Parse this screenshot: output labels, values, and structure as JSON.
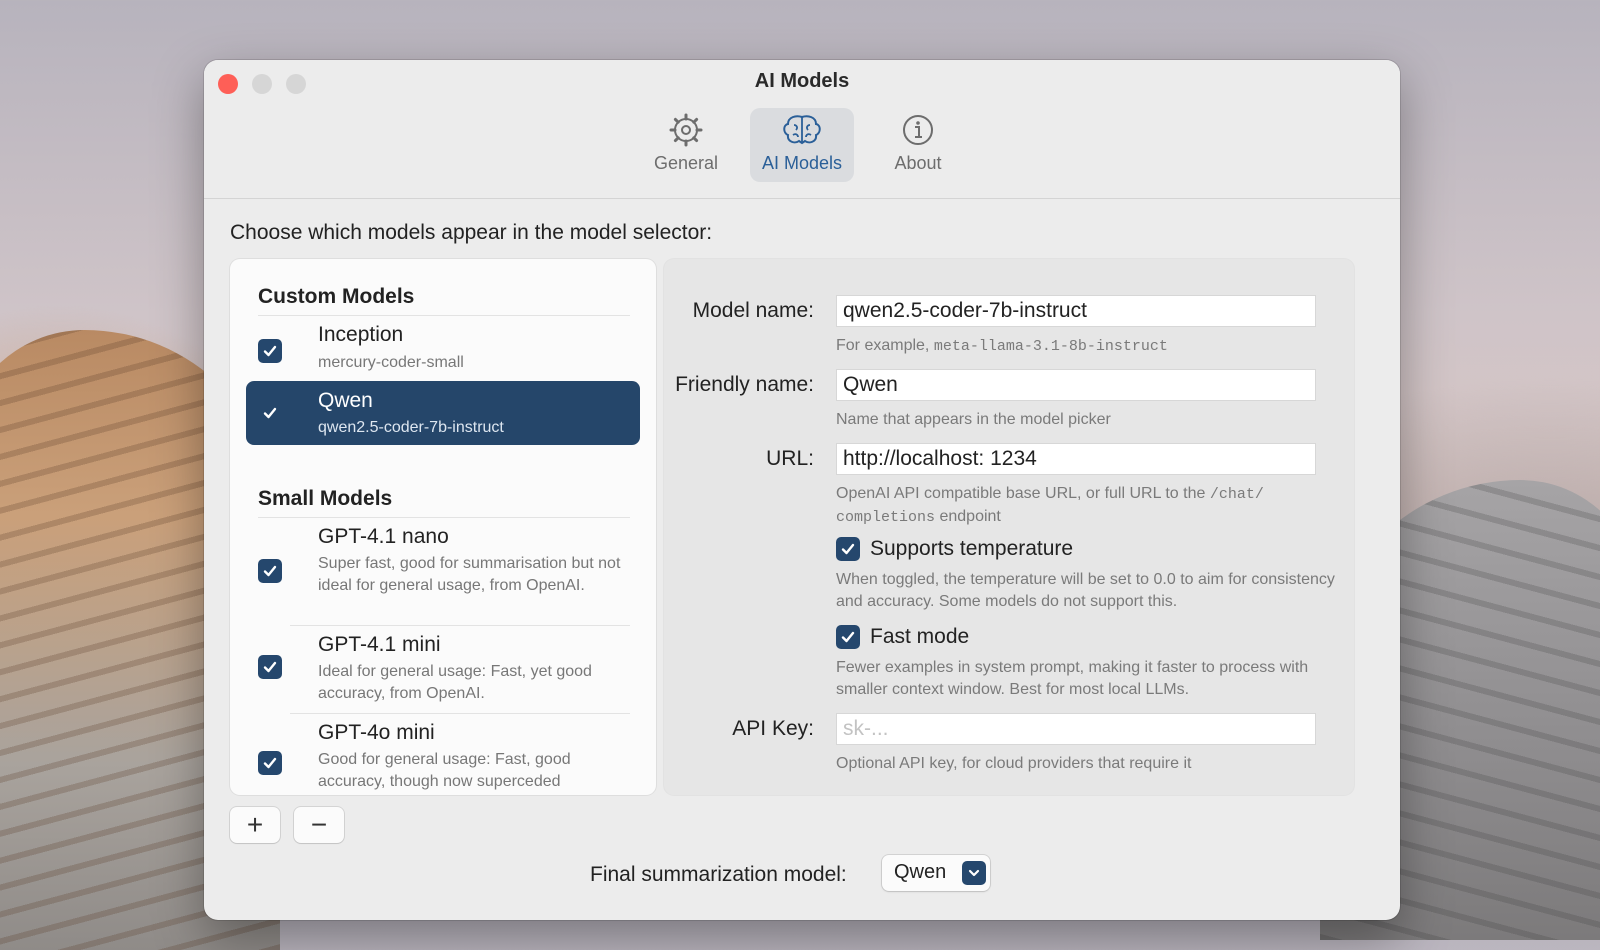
{
  "window": {
    "title": "AI Models"
  },
  "toolbar": {
    "tabs": [
      {
        "label": "General",
        "icon": "gear-icon"
      },
      {
        "label": "AI Models",
        "icon": "brain-icon"
      },
      {
        "label": "About",
        "icon": "info-icon"
      }
    ],
    "active_tab": "AI Models"
  },
  "main": {
    "instruction": "Choose which models appear in the model selector:",
    "sections": [
      {
        "title": "Custom Models",
        "items": [
          {
            "name": "Inception",
            "detail": "mercury-coder-small",
            "checked": true,
            "selected": false
          },
          {
            "name": "Qwen",
            "detail": "qwen2.5-coder-7b-instruct",
            "checked": true,
            "selected": true
          }
        ]
      },
      {
        "title": "Small Models",
        "items": [
          {
            "name": "GPT-4.1 nano",
            "detail": "Super fast, good for summarisation but not ideal for general usage, from OpenAI.",
            "checked": true,
            "selected": false
          },
          {
            "name": "GPT-4.1 mini",
            "detail": "Ideal for general usage: Fast, yet good accuracy, from OpenAI.",
            "checked": true,
            "selected": false
          },
          {
            "name": "GPT-4o mini",
            "detail": "Good for general usage: Fast, good accuracy, though now superceded",
            "checked": true,
            "selected": false
          }
        ]
      }
    ],
    "add_label": "+",
    "remove_label": "−"
  },
  "form": {
    "model_name": {
      "label": "Model name:",
      "value": "qwen2.5-coder-7b-instruct",
      "help_prefix": "For example, ",
      "help_code": "meta-llama-3.1-8b-instruct"
    },
    "friendly_name": {
      "label": "Friendly name:",
      "value": "Qwen",
      "help": "Name that appears in the model picker"
    },
    "url": {
      "label": "URL:",
      "value": "http://localhost: 1234",
      "help_prefix": "OpenAI API compatible base URL, or full URL to the ",
      "help_code": "/chat/ completions",
      "help_suffix": " endpoint"
    },
    "supports_temperature": {
      "label": "Supports temperature",
      "checked": true,
      "help": "When toggled, the temperature will be set to 0.0 to aim for consistency and accuracy. Some models do not support this."
    },
    "fast_mode": {
      "label": "Fast mode",
      "checked": true,
      "help": "Fewer examples in system prompt, making it faster to process with smaller context window. Best for most local LLMs."
    },
    "api_key": {
      "label": "API Key:",
      "value": "",
      "placeholder": "sk-...",
      "help": "Optional API key, for cloud providers that require it"
    }
  },
  "footer": {
    "final_label": "Final summarization model:",
    "final_value": "Qwen"
  },
  "colors": {
    "accent": "#25476d",
    "selected_row": "#25466a",
    "close": "#fe5f57"
  }
}
